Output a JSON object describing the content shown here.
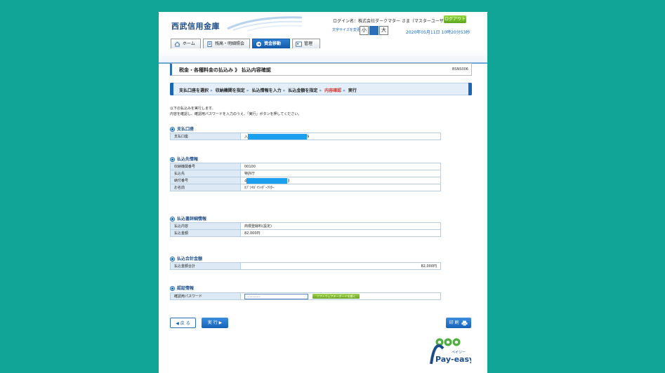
{
  "header": {
    "bank_name": "西武信用金庫",
    "login_text": "ログイン名：株式会社ダークマター さま（マスターユーザ）",
    "logout_label": "ログアウト",
    "fontsize_label": "文字サイズを変更",
    "fontsize_small": "小",
    "fontsize_large": "大",
    "datetime": "2020年05月11日 10時20分53秒"
  },
  "tabs": [
    {
      "label": "ホーム",
      "icon": "home-icon"
    },
    {
      "label": "残高・明細照会",
      "icon": "document-icon"
    },
    {
      "label": "資金移動",
      "icon": "transfer-icon"
    },
    {
      "label": "管理",
      "icon": "manage-icon"
    }
  ],
  "page": {
    "title": "税金・各種料金の払込み 》 払込内容確認",
    "code": "BSNS006"
  },
  "steps": [
    "支払口座を選択",
    "収納機関を指定",
    "払込情報を入力",
    "払込金額を指定",
    "内容確認",
    "実行"
  ],
  "intro": {
    "line1": "以下の払込みを実行します。",
    "line2": "内容を確認し、確認用パスワードを入力のうえ、「実行」ボタンを押してください。"
  },
  "sections": {
    "account": {
      "title": "支払口座",
      "rows": [
        {
          "label": "支払口座",
          "prefix": "入",
          "suffix": "9"
        }
      ]
    },
    "payee": {
      "title": "払込先情報",
      "rows": [
        {
          "label": "収納機関番号",
          "value": "00100"
        },
        {
          "label": "払込先",
          "value": "特許庁"
        },
        {
          "label": "納付番号",
          "prefix": "4",
          "suffix": "3"
        },
        {
          "label": "お名前",
          "value": "ｶﾌﾞｼｷｶﾞｲｼｬﾀﾞｰｸﾏﾀｰ"
        }
      ]
    },
    "detail": {
      "title": "払込書詳細情報",
      "rows": [
        {
          "label": "払込内容",
          "value": "商標登録料(設定)"
        },
        {
          "label": "払込金額",
          "value": "82,000円"
        }
      ]
    },
    "total": {
      "title": "払込合計金額",
      "rows": [
        {
          "label": "払込金額合計",
          "value": "82,000円"
        }
      ]
    },
    "auth": {
      "title": "認証情報",
      "rows": [
        {
          "label": "確認用パスワード",
          "value": "..........",
          "keyboard_label": "ソフトウェアキーボードを開く"
        }
      ]
    }
  },
  "buttons": {
    "back": "◀ 戻 る",
    "execute": "実 行 ▶",
    "print": "印 刷"
  },
  "logo": {
    "payeasy_small": "ペイジー",
    "payeasy_text": "Pay-easy"
  }
}
